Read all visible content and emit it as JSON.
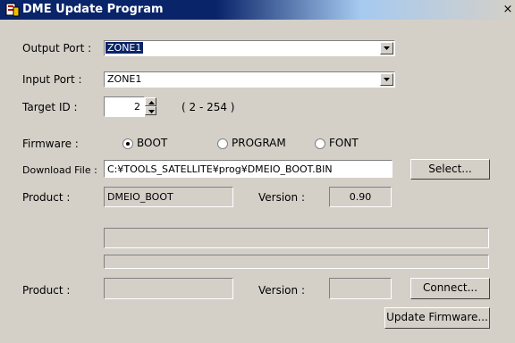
{
  "window": {
    "title": "DME Update Program",
    "close": "×"
  },
  "output_port": {
    "label": "Output Port :",
    "value": "ZONE1"
  },
  "input_port": {
    "label": "Input Port :",
    "value": "ZONE1"
  },
  "target_id": {
    "label": "Target ID :",
    "value": "2",
    "range": "( 2 - 254 )"
  },
  "firmware": {
    "label": "Firmware :",
    "options": [
      {
        "label": "BOOT",
        "selected": true
      },
      {
        "label": "PROGRAM",
        "selected": false
      },
      {
        "label": "FONT",
        "selected": false
      }
    ]
  },
  "download_file": {
    "label": "Download File :",
    "value": "C:¥TOOLS_SATELLITE¥prog¥DMEIO_BOOT.BIN",
    "select_button": "Select..."
  },
  "product_file": {
    "label": "Product :",
    "value": "DMEIO_BOOT",
    "version_label": "Version :",
    "version_value": "0.90"
  },
  "progress": {
    "bar1": 0,
    "bar2": 0
  },
  "product_device": {
    "label": "Product :",
    "value": "",
    "version_label": "Version :",
    "version_value": "",
    "connect_button": "Connect..."
  },
  "update_button": "Update Firmware..."
}
